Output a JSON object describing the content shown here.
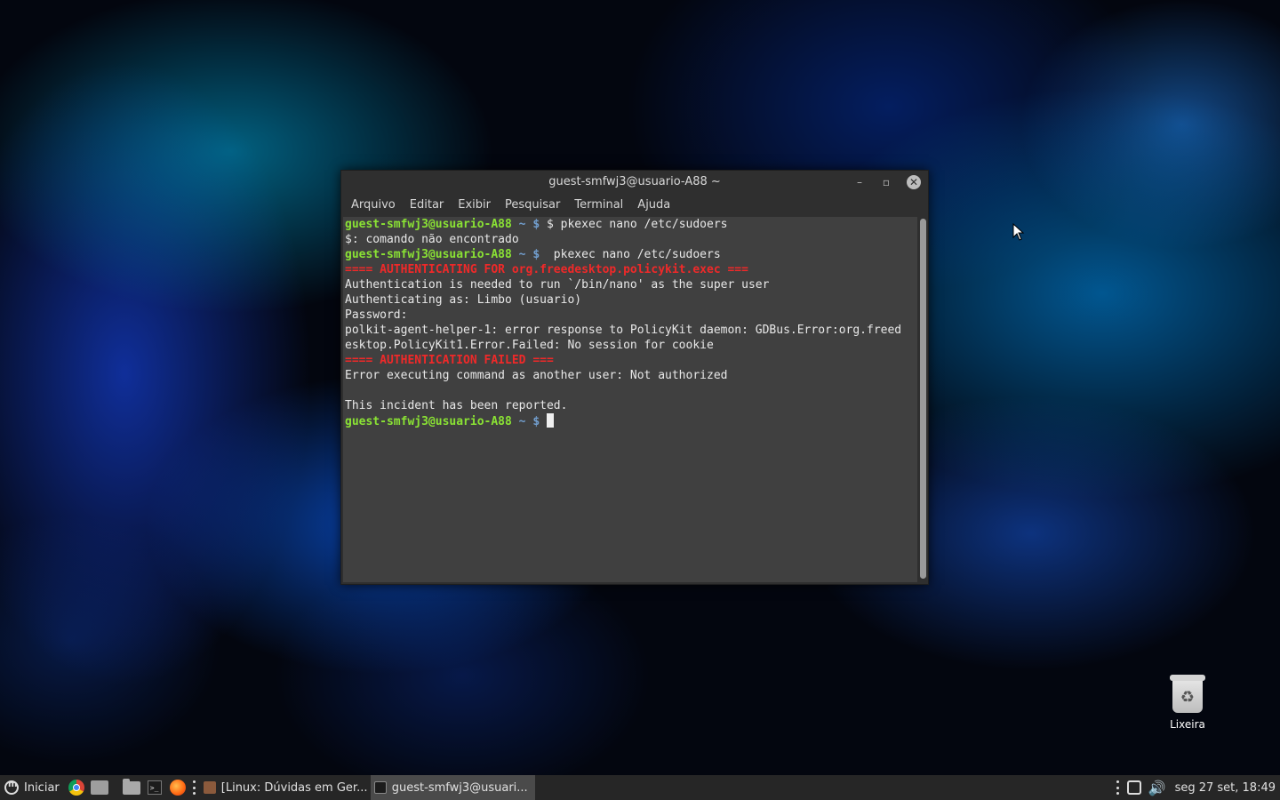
{
  "terminal": {
    "title": "guest-smfwj3@usuario-A88 ~",
    "window_buttons": {
      "minimize": "–",
      "maximize": "▫",
      "close": "✕"
    },
    "menu": [
      "Arquivo",
      "Editar",
      "Exibir",
      "Pesquisar",
      "Terminal",
      "Ajuda"
    ],
    "lines": [
      {
        "user": "guest-smfwj3@usuario-A88",
        "sym": " ~ $",
        "text": " $ pkexec nano /etc/sudoers"
      },
      {
        "text": "$: comando não encontrado"
      },
      {
        "user": "guest-smfwj3@usuario-A88",
        "sym": " ~ $",
        "text": "  pkexec nano /etc/sudoers"
      },
      {
        "err": "==== AUTHENTICATING FOR org.freedesktop.policykit.exec ==="
      },
      {
        "text": "Authentication is needed to run `/bin/nano' as the super user"
      },
      {
        "text": "Authenticating as: Limbo (usuario)"
      },
      {
        "text": "Password:"
      },
      {
        "text": "polkit-agent-helper-1: error response to PolicyKit daemon: GDBus.Error:org.freed"
      },
      {
        "text": "esktop.PolicyKit1.Error.Failed: No session for cookie"
      },
      {
        "err": "==== AUTHENTICATION FAILED ==="
      },
      {
        "text": "Error executing command as another user: Not authorized"
      },
      {
        "text": ""
      },
      {
        "text": "This incident has been reported."
      },
      {
        "user": "guest-smfwj3@usuario-A88",
        "sym": " ~ $",
        "text": " ",
        "cursor": true
      }
    ]
  },
  "desktop": {
    "trash_label": "Lixeira",
    "trash_icon": "recycle-icon"
  },
  "taskbar": {
    "start_label": "Iniciar",
    "launchers": [
      "chrome-icon",
      "files-icon",
      "folder-icon",
      "terminal-icon",
      "firefox-icon"
    ],
    "tasks": [
      {
        "label": "[Linux: Dúvidas em Ger...",
        "icon": "firefox-task-icon",
        "active": false
      },
      {
        "label": "guest-smfwj3@usuari...",
        "icon": "terminal-task-icon",
        "active": true
      }
    ],
    "clock": "seg 27 set, 18:49"
  },
  "colors": {
    "prompt_user": "#8ae234",
    "prompt_symbol": "#729fcf",
    "error": "#ef2929",
    "terminal_bg": "#404040",
    "taskbar_bg": "#262626"
  }
}
